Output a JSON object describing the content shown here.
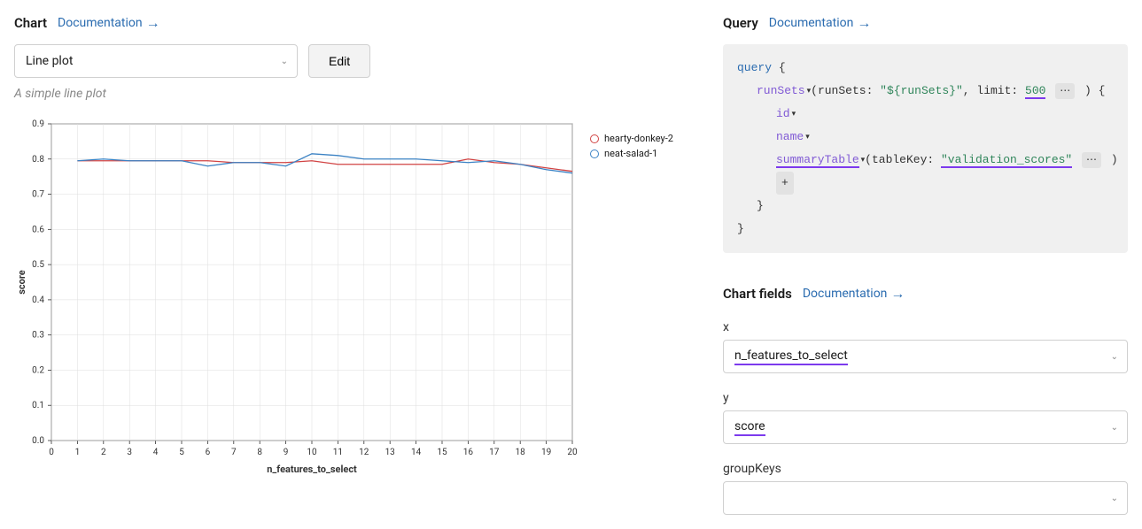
{
  "chart_section": {
    "title": "Chart",
    "doc_link": "Documentation",
    "type_select": "Line plot",
    "edit_label": "Edit",
    "desc": "A simple line plot"
  },
  "query_section": {
    "title": "Query",
    "doc_link": "Documentation",
    "tokens": {
      "query_kw": "query",
      "runSets_field": "runSets",
      "runSets_arg": "runSets",
      "runSets_val": "\"${runSets}\"",
      "limit_arg": "limit",
      "limit_val": "500",
      "id_field": "id",
      "name_field": "name",
      "summaryTable_field": "summaryTable",
      "tableKey_arg": "tableKey",
      "tableKey_val": "\"validation_scores\"",
      "plus": "+"
    }
  },
  "chart_fields": {
    "title": "Chart fields",
    "doc_link": "Documentation",
    "x_label": "x",
    "x_value": "n_features_to_select",
    "y_label": "y",
    "y_value": "score",
    "groupKeys_label": "groupKeys",
    "groupKeys_value": ""
  },
  "chart_data": {
    "type": "line",
    "xlabel": "n_features_to_select",
    "ylabel": "score",
    "xlim": [
      0,
      20
    ],
    "ylim": [
      0.0,
      0.9
    ],
    "x_ticks": [
      0,
      1,
      2,
      3,
      4,
      5,
      6,
      7,
      8,
      9,
      10,
      11,
      12,
      13,
      14,
      15,
      16,
      17,
      18,
      19,
      20
    ],
    "y_ticks": [
      0.0,
      0.1,
      0.2,
      0.3,
      0.4,
      0.5,
      0.6,
      0.7,
      0.8,
      0.9
    ],
    "series": [
      {
        "name": "hearty-donkey-2",
        "color": "#d14343",
        "x": [
          1,
          2,
          3,
          4,
          5,
          6,
          7,
          8,
          9,
          10,
          11,
          12,
          13,
          14,
          15,
          16,
          17,
          18,
          19,
          20
        ],
        "values": [
          0.795,
          0.795,
          0.795,
          0.795,
          0.795,
          0.795,
          0.79,
          0.79,
          0.79,
          0.795,
          0.785,
          0.785,
          0.785,
          0.785,
          0.785,
          0.8,
          0.79,
          0.785,
          0.775,
          0.765
        ]
      },
      {
        "name": "neat-salad-1",
        "color": "#3b82c4",
        "x": [
          1,
          2,
          3,
          4,
          5,
          6,
          7,
          8,
          9,
          10,
          11,
          12,
          13,
          14,
          15,
          16,
          17,
          18,
          19,
          20
        ],
        "values": [
          0.795,
          0.8,
          0.795,
          0.795,
          0.795,
          0.78,
          0.79,
          0.79,
          0.78,
          0.815,
          0.81,
          0.8,
          0.8,
          0.8,
          0.795,
          0.79,
          0.795,
          0.785,
          0.77,
          0.76
        ]
      }
    ],
    "legend": [
      "hearty-donkey-2",
      "neat-salad-1"
    ],
    "legend_colors": {
      "hearty-donkey-2": "#d14343",
      "neat-salad-1": "#3b82c4"
    }
  }
}
